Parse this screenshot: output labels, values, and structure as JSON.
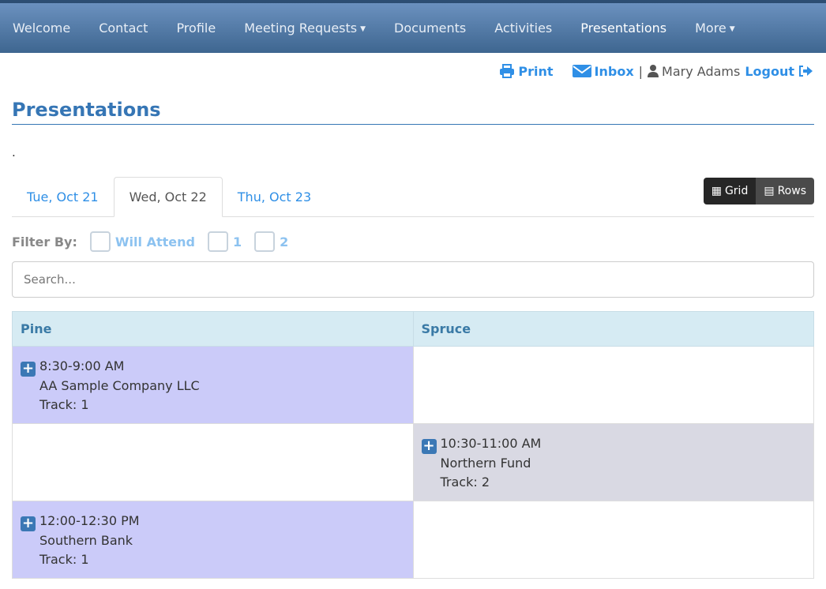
{
  "nav": {
    "items": [
      {
        "label": "Welcome"
      },
      {
        "label": "Contact"
      },
      {
        "label": "Profile"
      },
      {
        "label": "Meeting Requests",
        "dropdown": true
      },
      {
        "label": "Documents"
      },
      {
        "label": "Activities"
      },
      {
        "label": "Presentations",
        "active": true
      },
      {
        "label": "More",
        "dropdown": true
      }
    ]
  },
  "topbar": {
    "print": "Print",
    "inbox": "Inbox",
    "separator": "|",
    "user": "Mary Adams",
    "logout": "Logout"
  },
  "page": {
    "title": "Presentations",
    "note": "."
  },
  "tabs": [
    {
      "label": "Tue, Oct 21"
    },
    {
      "label": "Wed, Oct 22",
      "active": true
    },
    {
      "label": "Thu, Oct 23"
    }
  ],
  "view_toggle": {
    "grid": "Grid",
    "rows": "Rows"
  },
  "filter": {
    "label": "Filter By:",
    "options": [
      "Will Attend",
      "1",
      "2"
    ]
  },
  "search": {
    "placeholder": "Search...",
    "value": ""
  },
  "grid": {
    "columns": [
      "Pine",
      "Spruce"
    ],
    "rows": [
      [
        {
          "time": "8:30-9:00 AM",
          "company": "AA Sample Company LLC",
          "track": "Track: 1"
        },
        null
      ],
      [
        null,
        {
          "time": "10:30-11:00 AM",
          "company": "Northern Fund",
          "track": "Track: 2"
        }
      ],
      [
        {
          "time": "12:00-12:30 PM",
          "company": "Southern Bank",
          "track": "Track: 1"
        },
        null
      ]
    ]
  },
  "colors": {
    "track1": "#cbcbf9",
    "track2": "#d9d9e3",
    "link": "#2f8fe6",
    "title": "#3676b5"
  }
}
